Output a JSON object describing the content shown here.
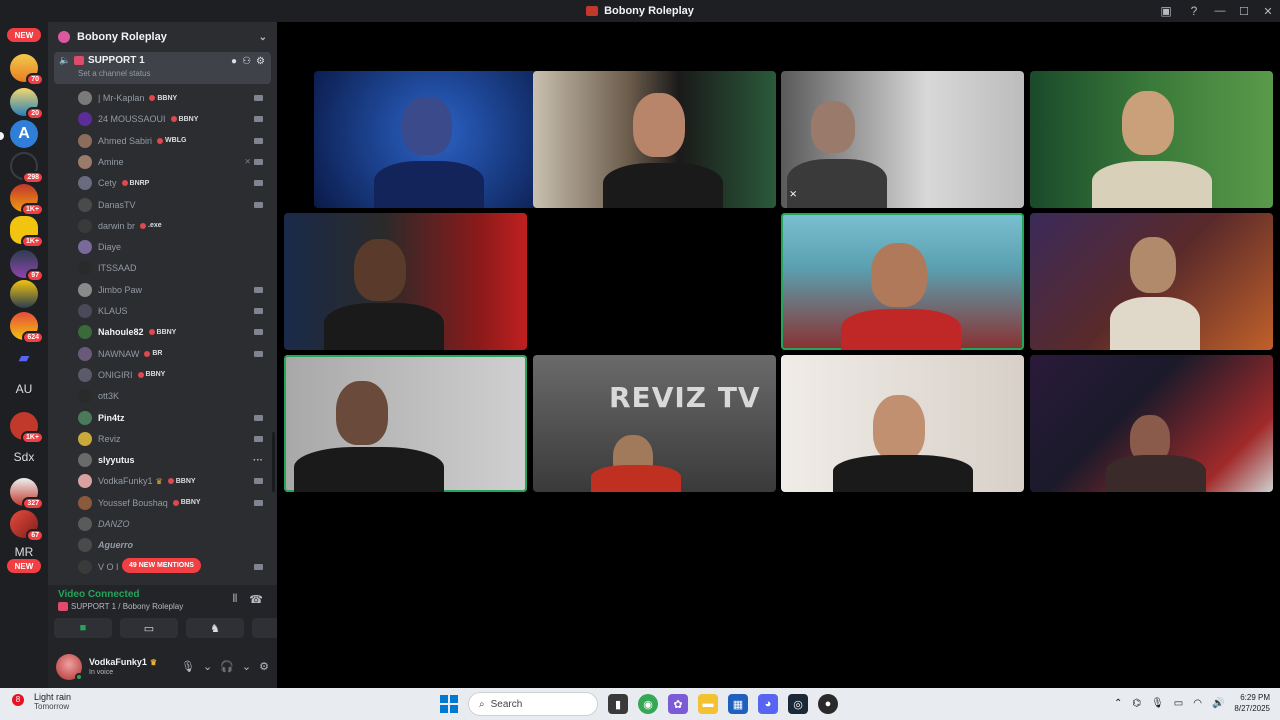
{
  "window": {
    "title": "Bobony Roleplay"
  },
  "server_rail": {
    "new_top": "NEW",
    "badges": [
      "70",
      "20",
      "298",
      "1K+",
      "1K+",
      "97",
      "624",
      "1K+",
      "327",
      "67"
    ],
    "texts": [
      "AU",
      "Sdx",
      "MR"
    ],
    "new_bottom": "NEW"
  },
  "guild": {
    "name": "Bobony Roleplay"
  },
  "channel": {
    "name": "SUPPORT 1",
    "status_placeholder": "Set a channel status"
  },
  "members": [
    {
      "name": "| Mr-Kaplan",
      "tag": "BBNY",
      "active": false,
      "cam": true,
      "color": "#7a7a7a"
    },
    {
      "name": "24 MOUSSAOUI",
      "tag": "BBNY",
      "active": false,
      "cam": true,
      "color": "#5b2c9a"
    },
    {
      "name": "Ahmed Sabiri",
      "tag": "WBLG",
      "active": false,
      "cam": true,
      "color": "#8a6d5a"
    },
    {
      "name": "Amine",
      "tag": "",
      "active": false,
      "cam": true,
      "muted": true,
      "color": "#9a7a6a"
    },
    {
      "name": "Cety",
      "tag": "BNRP",
      "active": false,
      "cam": true,
      "color": "#6a6a80"
    },
    {
      "name": "DanasTV",
      "tag": "",
      "active": false,
      "cam": true,
      "color": "#4a4a4a"
    },
    {
      "name": "darwin br",
      "tag": ".exe",
      "active": false,
      "cam": false,
      "color": "#3a3a3a"
    },
    {
      "name": "Diaye",
      "tag": "",
      "active": false,
      "cam": false,
      "color": "#7a6a9a"
    },
    {
      "name": "ITSSAAD",
      "tag": "",
      "active": false,
      "cam": false,
      "color": "#2a2a2a"
    },
    {
      "name": "Jimbo Paw",
      "tag": "",
      "active": false,
      "cam": true,
      "color": "#8a8a8a"
    },
    {
      "name": "KLAUS",
      "tag": "",
      "active": false,
      "cam": true,
      "color": "#4a4a5a"
    },
    {
      "name": "Nahoule82",
      "tag": "BBNY",
      "active": true,
      "cam": true,
      "color": "#3a6a3a"
    },
    {
      "name": "NAWNAW",
      "tag": "BR",
      "active": false,
      "cam": true,
      "color": "#6a5a7a"
    },
    {
      "name": "ONIGIRI",
      "tag": "BBNY",
      "active": false,
      "cam": false,
      "color": "#5a5a6a"
    },
    {
      "name": "ott3K",
      "tag": "",
      "active": false,
      "cam": false,
      "color": "#2a2a2a"
    },
    {
      "name": "Pin4tz",
      "tag": "",
      "active": true,
      "cam": true,
      "color": "#4a7a5a"
    },
    {
      "name": "Reviz",
      "tag": "",
      "active": false,
      "cam": true,
      "color": "#c9a93a"
    },
    {
      "name": "slyyutus",
      "tag": "",
      "active": true,
      "cam": false,
      "more": true,
      "color": "#6a6a6a"
    },
    {
      "name": "VodkaFunky1",
      "tag": "BBNY",
      "active": false,
      "cam": true,
      "crown": true,
      "color": "#d9a0a0"
    },
    {
      "name": "Youssef Boushaq",
      "tag": "BBNY",
      "active": false,
      "cam": true,
      "color": "#8a5a3a"
    },
    {
      "name": "DANZO",
      "tag": "",
      "active": false,
      "cam": false,
      "italic": true,
      "color": "#5a5a5a"
    },
    {
      "name": "Aguerro",
      "tag": "",
      "active": false,
      "cam": false,
      "italic": true,
      "bold": true,
      "color": "#4a4a4a"
    },
    {
      "name": "V O I",
      "tag": "",
      "active": false,
      "cam": true,
      "color": "#3a3a3a"
    }
  ],
  "mentions": {
    "label": "49 NEW MENTIONS"
  },
  "voice": {
    "status": "Video Connected",
    "channel": "SUPPORT 1 / Bobony Roleplay"
  },
  "user": {
    "name": "VodkaFunky1",
    "status": "In voice"
  },
  "video_text": {
    "reviz": "REVIZ TV"
  },
  "taskbar": {
    "weather_badge": "8",
    "weather": "Light rain",
    "weather_sub": "Tomorrow",
    "search_placeholder": "Search",
    "time": "6:29 PM",
    "date": "8/27/2025"
  },
  "colors": {
    "accent_green": "#23a55a",
    "alert_red": "#f23f43",
    "sidebar_bg": "#2b2d31"
  }
}
